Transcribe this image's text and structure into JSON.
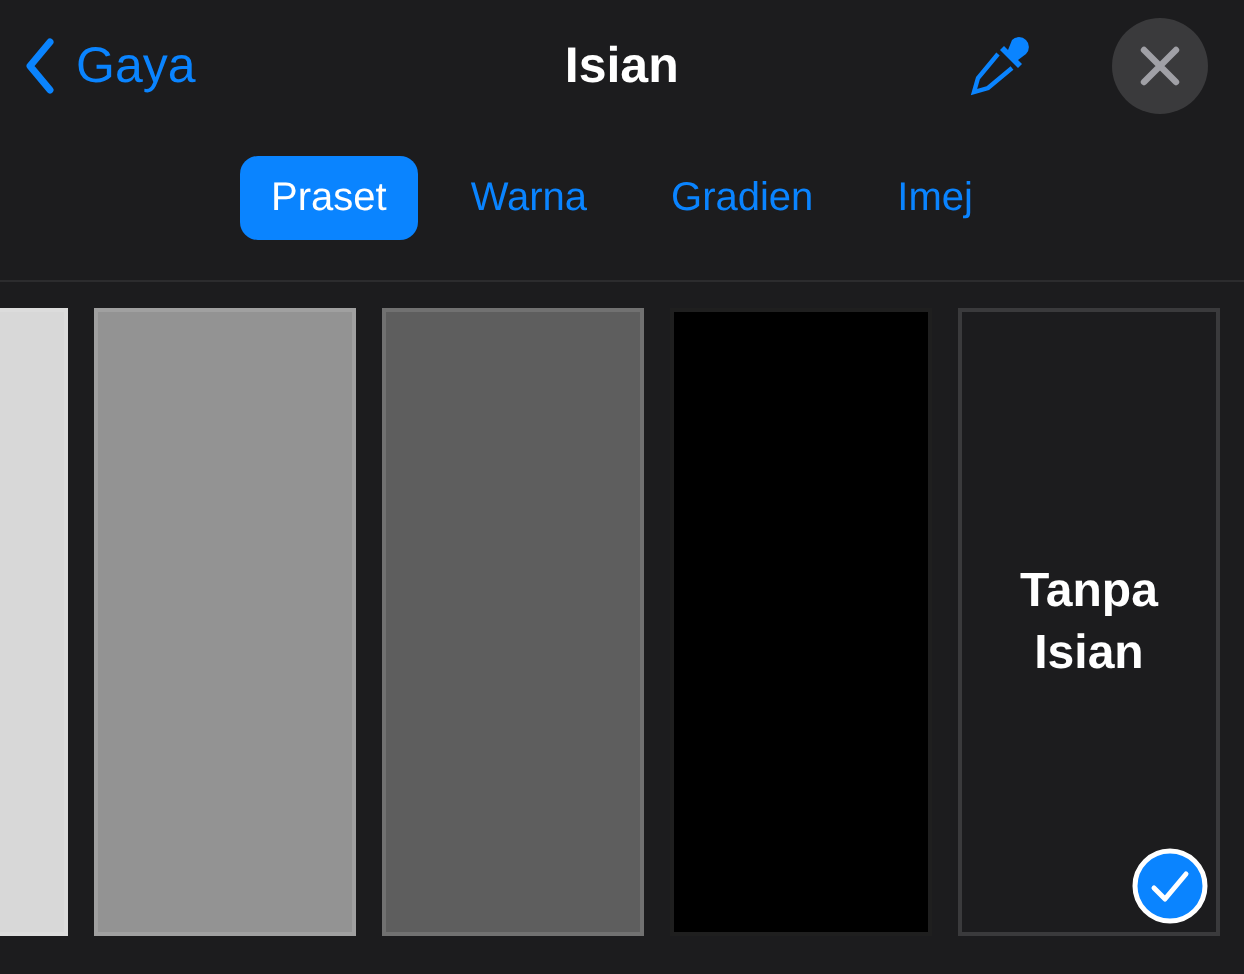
{
  "header": {
    "back_label": "Gaya",
    "title": "Isian"
  },
  "tabs": [
    {
      "label": "Praset",
      "selected": true
    },
    {
      "label": "Warna",
      "selected": false
    },
    {
      "label": "Gradien",
      "selected": false
    },
    {
      "label": "Imej",
      "selected": false
    }
  ],
  "swatches": [
    {
      "kind": "color",
      "color": "#d8d8d8",
      "selected": false
    },
    {
      "kind": "color",
      "color": "#939393",
      "selected": false
    },
    {
      "kind": "color",
      "color": "#5e5e5e",
      "selected": false
    },
    {
      "kind": "color",
      "color": "#000000",
      "selected": false
    },
    {
      "kind": "none",
      "label": "Tanpa Isian",
      "selected": true
    }
  ]
}
